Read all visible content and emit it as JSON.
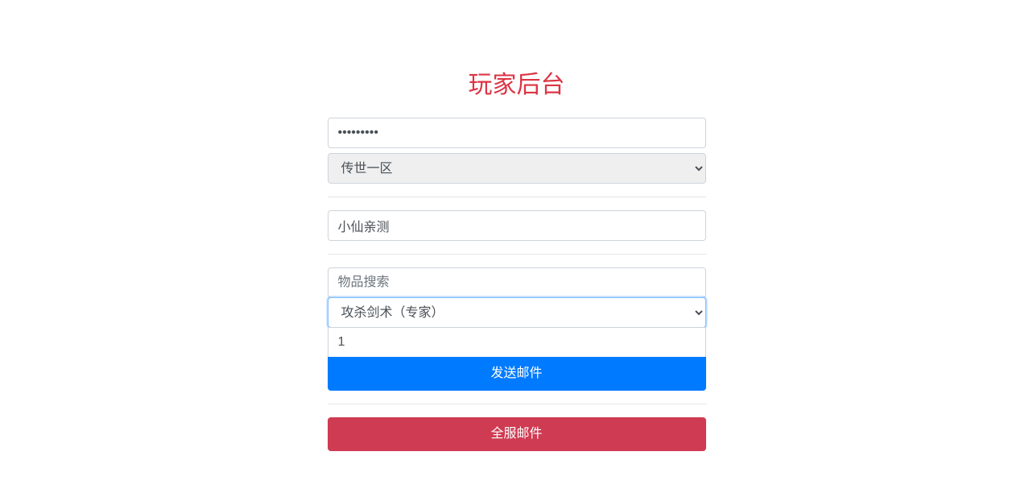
{
  "title": "玩家后台",
  "password": {
    "value": "•••••••••"
  },
  "serverSelect": {
    "selected": "传世一区"
  },
  "characterName": {
    "value": "小仙亲测"
  },
  "itemSearch": {
    "placeholder": "物品搜索",
    "value": ""
  },
  "itemSelect": {
    "selected": "攻杀剑术（专家）"
  },
  "quantity": {
    "value": "1"
  },
  "sendButton": "发送邮件",
  "globalMailButton": "全服邮件"
}
